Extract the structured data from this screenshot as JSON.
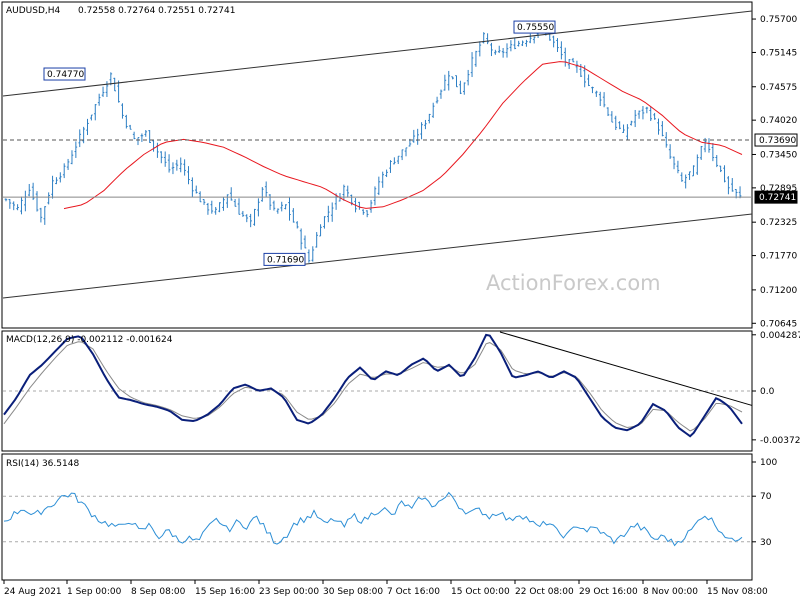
{
  "chart_data": [
    {
      "type": "candlestick",
      "header": {
        "symbol": "AUDUSD,H4",
        "ohlc": "0.72558 0.72764 0.72551 0.72741"
      },
      "price_axis": {
        "range": [
          0.706,
          0.7595
        ],
        "ticks": [
          "0.75700",
          "0.75145",
          "0.74575",
          "0.74020",
          "0.73450",
          "0.72895",
          "0.72325",
          "0.71770",
          "0.71200",
          "0.70645"
        ]
      },
      "x_labels": [
        "24 Aug 2021",
        "1 Sep 00:00",
        "8 Sep 08:00",
        "15 Sep 16:00",
        "23 Sep 00:00",
        "30 Sep 08:00",
        "7 Oct 16:00",
        "15 Oct 00:00",
        "22 Oct 08:00",
        "29 Oct 16:00",
        "8 Nov 00:00",
        "15 Nov 08:00"
      ],
      "price_callouts": [
        {
          "text": "0.74770",
          "value": 0.7477
        },
        {
          "text": "0.75550",
          "value": 0.7555
        },
        {
          "text": "0.71690",
          "value": 0.7169
        }
      ],
      "level_line": {
        "value": 0.7369,
        "label": "0.73690"
      },
      "current_price": {
        "value": 0.72741,
        "label": "0.72741"
      },
      "price_anchors": [
        0.727,
        0.7255,
        0.729,
        0.724,
        0.73,
        0.732,
        0.736,
        0.74,
        0.744,
        0.7477,
        0.741,
        0.737,
        0.738,
        0.735,
        0.732,
        0.733,
        0.729,
        0.726,
        0.725,
        0.728,
        0.725,
        0.723,
        0.729,
        0.725,
        0.726,
        0.722,
        0.7169,
        0.723,
        0.726,
        0.729,
        0.726,
        0.725,
        0.73,
        0.733,
        0.735,
        0.737,
        0.74,
        0.744,
        0.748,
        0.745,
        0.75,
        0.754,
        0.751,
        0.752,
        0.753,
        0.754,
        0.7555,
        0.753,
        0.75,
        0.749,
        0.746,
        0.744,
        0.74,
        0.738,
        0.741,
        0.742,
        0.739,
        0.734,
        0.73,
        0.732,
        0.7369,
        0.733,
        0.729,
        0.7274
      ],
      "moving_average_anchors": [
        0.7255,
        0.7262,
        0.7285,
        0.7318,
        0.7345,
        0.7365,
        0.737,
        0.7365,
        0.7357,
        0.7342,
        0.7325,
        0.731,
        0.73,
        0.729,
        0.727,
        0.7255,
        0.7258,
        0.727,
        0.7285,
        0.731,
        0.7345,
        0.7385,
        0.743,
        0.7465,
        0.7495,
        0.75,
        0.749,
        0.747,
        0.745,
        0.7435,
        0.741,
        0.738,
        0.7365,
        0.736,
        0.7345
      ]
    },
    {
      "type": "line",
      "label": "MACD(12,26,9) -0.002112 -0.001624",
      "range": [
        -0.0045,
        0.0045
      ],
      "ticks": [
        "0.004287",
        "0.0",
        "-0.003726"
      ],
      "tick_values": [
        0.004287,
        0.0,
        -0.003726
      ],
      "macd_anchors": [
        -0.0018,
        -0.0005,
        0.0012,
        0.002,
        0.003,
        0.004,
        0.0042,
        0.0028,
        0.001,
        -0.0005,
        -0.0007,
        -0.001,
        -0.0012,
        -0.0015,
        -0.0022,
        -0.0023,
        -0.0018,
        -0.001,
        0.0002,
        0.0005,
        0.0,
        0.0002,
        -0.0005,
        -0.0022,
        -0.0025,
        -0.0018,
        -0.0005,
        0.001,
        0.0018,
        0.0008,
        0.0015,
        0.0012,
        0.002,
        0.0025,
        0.0015,
        0.002,
        0.001,
        0.0025,
        0.0045,
        0.003,
        0.001,
        0.0012,
        0.0015,
        0.001,
        0.0015,
        0.001,
        -0.0005,
        -0.002,
        -0.0028,
        -0.003,
        -0.0025,
        -0.001,
        -0.0015,
        -0.0028,
        -0.0035,
        -0.002,
        -0.0005,
        -0.0012,
        -0.0025
      ],
      "signal_anchors": [
        -0.0025,
        -0.0012,
        0.0002,
        0.0014,
        0.0025,
        0.0035,
        0.0038,
        0.0032,
        0.0016,
        0.0002,
        -0.0005,
        -0.0009,
        -0.0011,
        -0.0014,
        -0.0019,
        -0.0021,
        -0.0019,
        -0.0012,
        -0.0002,
        0.0003,
        0.0001,
        0.0001,
        -0.0003,
        -0.0016,
        -0.0022,
        -0.0019,
        -0.0009,
        0.0005,
        0.0013,
        0.001,
        0.0013,
        0.0013,
        0.0017,
        0.0022,
        0.0018,
        0.0019,
        0.0013,
        0.002,
        0.0038,
        0.0032,
        0.0016,
        0.0013,
        0.0014,
        0.0011,
        0.0014,
        0.0011,
        -0.0001,
        -0.0015,
        -0.0024,
        -0.0028,
        -0.0026,
        -0.0014,
        -0.0015,
        -0.0024,
        -0.0031,
        -0.0022,
        -0.0009,
        -0.0011,
        -0.0016
      ]
    },
    {
      "type": "line",
      "label": "RSI(14) 36.5148",
      "range": [
        0,
        100
      ],
      "ticks": [
        "100",
        "70",
        "30"
      ],
      "tick_values": [
        100,
        70,
        30
      ],
      "rsi_anchors": [
        48,
        54,
        60,
        52,
        58,
        63,
        70,
        72,
        64,
        55,
        48,
        45,
        42,
        50,
        38,
        45,
        34,
        40,
        31,
        33,
        30,
        42,
        50,
        40,
        47,
        44,
        52,
        40,
        29,
        35,
        47,
        50,
        55,
        45,
        50,
        43,
        53,
        48,
        55,
        60,
        52,
        65,
        58,
        70,
        62,
        66,
        72,
        60,
        55,
        58,
        52,
        57,
        48,
        55,
        50,
        42,
        48,
        38,
        35,
        45,
        40,
        42,
        35,
        30,
        38,
        45,
        40,
        32,
        35,
        28,
        34,
        42,
        55,
        48,
        38,
        30,
        36
      ]
    },
    {
      "watermark": "ActionForex.com"
    }
  ]
}
